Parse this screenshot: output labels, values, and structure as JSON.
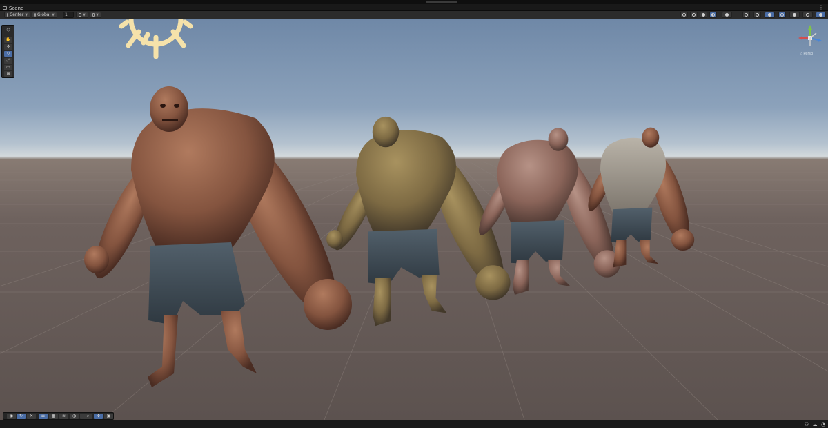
{
  "window": {
    "tab_title": "Scene",
    "tab_menu_glyph": "⋮"
  },
  "toolbar": {
    "pivot_mode": "Center",
    "pivot_rotation": "Global",
    "grid_increment": "1",
    "grid_snap_icon": "grid-snap-icon",
    "increment_snap_icon": "increment-snap-icon",
    "right_icons": [
      "orientation-icon",
      "wireframe-shading-icon",
      "shaded-shading-icon",
      "lit-shading-icon",
      "draw-mode-icon",
      "2d-toggle-icon",
      "lighting-toggle-icon",
      "audio-effects-icon",
      "fx-icon",
      "hidden-objects-icon",
      "gizmos-icon",
      "camera-settings-icon"
    ]
  },
  "tools": [
    {
      "name": "view-tool",
      "glyph": "✋",
      "active": false
    },
    {
      "name": "move-tool",
      "glyph": "✥",
      "active": false
    },
    {
      "name": "rotate-tool",
      "glyph": "↻",
      "active": true
    },
    {
      "name": "scale-tool",
      "glyph": "⤢",
      "active": false
    },
    {
      "name": "rect-tool",
      "glyph": "▭",
      "active": false
    },
    {
      "name": "transform-tool",
      "glyph": "⊞",
      "active": false
    }
  ],
  "tool_palette_header_glyph": "⬡",
  "gizmo": {
    "projection_label": "◁ Persp"
  },
  "overlay_tools": [
    {
      "name": "shading-mode-icon",
      "glyph": "◉",
      "on": false
    },
    {
      "name": "refresh-icon",
      "glyph": "↻",
      "on": true
    },
    {
      "name": "tools-icon",
      "glyph": "✕",
      "on": false
    },
    {
      "name": "layers-icon",
      "glyph": "☰",
      "on": true
    },
    {
      "name": "grid-icon",
      "glyph": "▦",
      "on": false
    },
    {
      "name": "filter-icon",
      "glyph": "≋",
      "on": false
    },
    {
      "name": "lighting-icon",
      "glyph": "◑",
      "on": false
    },
    {
      "name": "fx-icon",
      "glyph": "✦",
      "on": false
    },
    {
      "name": "search-icon",
      "glyph": "⌕",
      "on": false
    },
    {
      "name": "move-icon",
      "glyph": "✢",
      "on": true
    },
    {
      "name": "camera-icon",
      "glyph": "▣",
      "on": false
    }
  ],
  "status_icons": [
    "collab-icon",
    "cloud-icon",
    "notifications-icon"
  ],
  "colors": {
    "accent": "#4a6da6",
    "sun_gizmo": "#f3dfa5",
    "ground": "#6a5e5a",
    "sky": "#7f96b2",
    "creature_skin": "#8a5a44"
  }
}
